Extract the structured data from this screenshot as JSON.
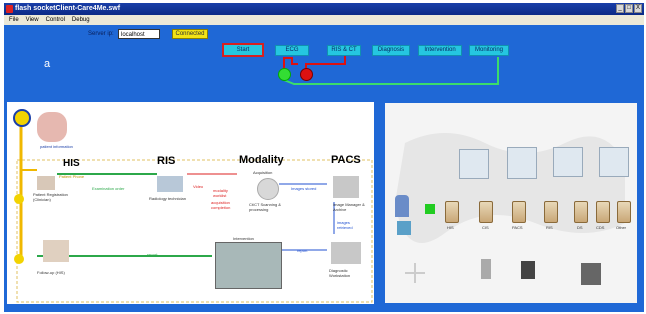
{
  "window": {
    "title": "flash socketClient-Care4Me.swf",
    "controls": [
      "_",
      "□",
      "X"
    ]
  },
  "menu": [
    "File",
    "View",
    "Control",
    "Debug"
  ],
  "toolbar": {
    "server_label": "Server ip:",
    "server_value": "localhost",
    "status": "Connected",
    "panel_label": "a",
    "buttons": [
      "Start",
      "ECG",
      "RIS & CT",
      "Diagnosis",
      "Intervention",
      "Monitoring"
    ]
  },
  "workflow": {
    "sections": [
      "HIS",
      "RIS",
      "Modality",
      "PACS"
    ],
    "labels": {
      "patient_info": "patient information",
      "patient_phone": "Patient Phone",
      "patient_reg": "Patient Registration (Clinician)",
      "exam_order": "Examination order",
      "radiology_tech": "Radiology technician",
      "modality_worklist": "modality worklist",
      "acquisition_complete": "acquisition completion",
      "acquisition": "Acquisition",
      "ct_scanning": "Ct/CT Scanning & processing",
      "images_stored": "Images stored",
      "image_manager": "Image Manager & Archive",
      "images_retrieved": "images retrieved",
      "diagnostic_ws": "Diagnostic Workstation",
      "intervention": "Intervention",
      "report_left": "report",
      "report_right": "report",
      "follow_up": "Follow-up (HIS)",
      "video": "Video"
    }
  },
  "network": {
    "server_labels": [
      "HIS",
      "CIS",
      "PACS",
      "RIS",
      "DS",
      "CDS",
      "Other"
    ]
  },
  "colors": {
    "stage": "#1f68d6",
    "button": "#25c6e0",
    "start_border": "#d62020",
    "connected": "#f2e314",
    "green_indicator": "#33dd33",
    "red_indicator": "#dd1111",
    "line_green": "#3bdc6a"
  }
}
